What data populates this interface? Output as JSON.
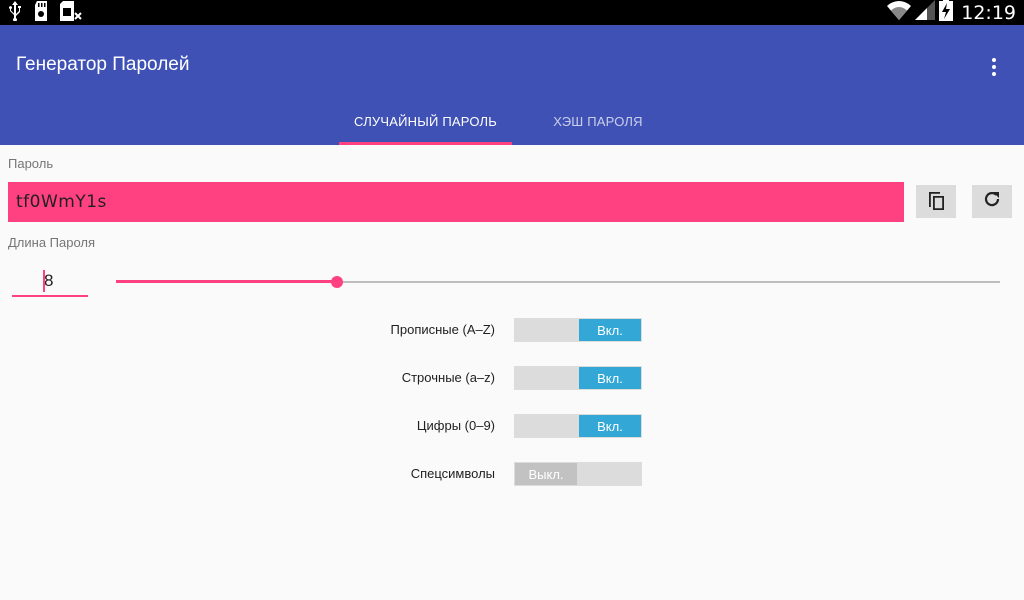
{
  "status_bar": {
    "time": "12:19",
    "left_icons": [
      "usb-icon",
      "sd-card-icon",
      "no-sim-icon"
    ],
    "right_icons": [
      "wifi-icon",
      "signal-icon",
      "battery-charging-icon"
    ]
  },
  "app_bar": {
    "title": "Генератор Паролей",
    "menu_icon": "overflow-menu-icon",
    "color": "#3f51b5"
  },
  "tabs": [
    {
      "label": "СЛУЧАЙНЫЙ ПАРОЛЬ",
      "selected": true
    },
    {
      "label": "ХЭШ ПАРОЛЯ",
      "selected": false
    }
  ],
  "password": {
    "label": "Пароль",
    "value": "tf0WmY1s",
    "copy_icon": "copy-icon",
    "refresh_icon": "refresh-icon",
    "field_color": "#ff4081"
  },
  "length": {
    "label": "Длина Пароля",
    "value": "8",
    "slider_fraction": 0.25
  },
  "options": [
    {
      "label": "Прописные (A–Z)",
      "state": "Вкл.",
      "on": true
    },
    {
      "label": "Строчные (a–z)",
      "state": "Вкл.",
      "on": true
    },
    {
      "label": "Цифры (0–9)",
      "state": "Вкл.",
      "on": true
    },
    {
      "label": "Спецсимволы",
      "state": "Выкл.",
      "on": false
    }
  ],
  "colors": {
    "accent": "#ff4081",
    "toggle_on": "#33a7d6"
  }
}
